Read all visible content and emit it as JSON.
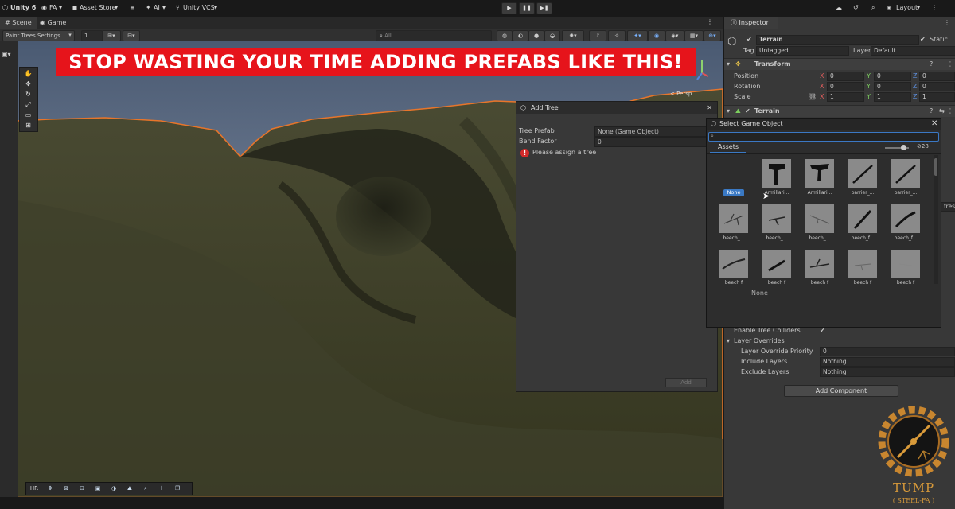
{
  "topbar": {
    "app": "Unity 6",
    "account": "FA",
    "asset_store": "Asset Store",
    "ai": "AI",
    "vcs": "Unity VCS",
    "layout": "Layout"
  },
  "tabs": {
    "scene": "Scene",
    "game": "Game",
    "inspector": "Inspector"
  },
  "toolbar": {
    "paint_mode": "Paint Trees Settings",
    "value": "1",
    "search_placeholder": "All"
  },
  "scene": {
    "persp": "< Persp"
  },
  "banner": "STOP WASTING YOUR TIME ADDING PREFABS LIKE THIS!",
  "add_tree": {
    "title": "Add Tree",
    "prefab_label": "Tree Prefab",
    "prefab_value": "None (Game Object)",
    "bend_label": "Bend Factor",
    "bend_value": "0",
    "error": "Please assign a tree",
    "add_button": "Add"
  },
  "select_object": {
    "title": "Select Game Object",
    "tab_assets": "Assets",
    "count": "28",
    "none_item": "None",
    "footer": "None",
    "items": [
      "Armillari...",
      "Armillari...",
      "barrier_...",
      "barrier_...",
      "beech_...",
      "beech_...",
      "beech_...",
      "beech_f...",
      "beech_f...",
      "beech f",
      "beech f",
      "beech f",
      "beech f",
      "beech f"
    ]
  },
  "inspector": {
    "object_name": "Terrain",
    "static_label": "Static",
    "tag_label": "Tag",
    "tag_value": "Untagged",
    "layer_label": "Layer",
    "layer_value": "Default",
    "transform_title": "Transform",
    "position_label": "Position",
    "rotation_label": "Rotation",
    "scale_label": "Scale",
    "axis_x": "X",
    "axis_y": "Y",
    "axis_z": "Z",
    "position": [
      "0",
      "0",
      "0"
    ],
    "rotation": [
      "0",
      "0",
      "0"
    ],
    "scale": [
      "1",
      "1",
      "1"
    ],
    "terrain_title": "Terrain",
    "refresh_partial": "fresh",
    "enable_colliders": "Enable Tree Colliders",
    "layer_overrides": "Layer Overrides",
    "priority_label": "Layer Override Priority",
    "priority_value": "0",
    "include_label": "Include Layers",
    "include_value": "Nothing",
    "exclude_label": "Exclude Layers",
    "exclude_value": "Nothing",
    "add_component": "Add Component"
  },
  "bottom_tools": {
    "hr": "HR"
  },
  "watermark": {
    "line1": "TUMP",
    "line2": "( STEEL-FA )"
  },
  "colors": {
    "banner": "#e6141b",
    "terrain": "#3d3f2a",
    "selection_outline": "#e8752a",
    "accent_blue": "#3a79c4"
  }
}
